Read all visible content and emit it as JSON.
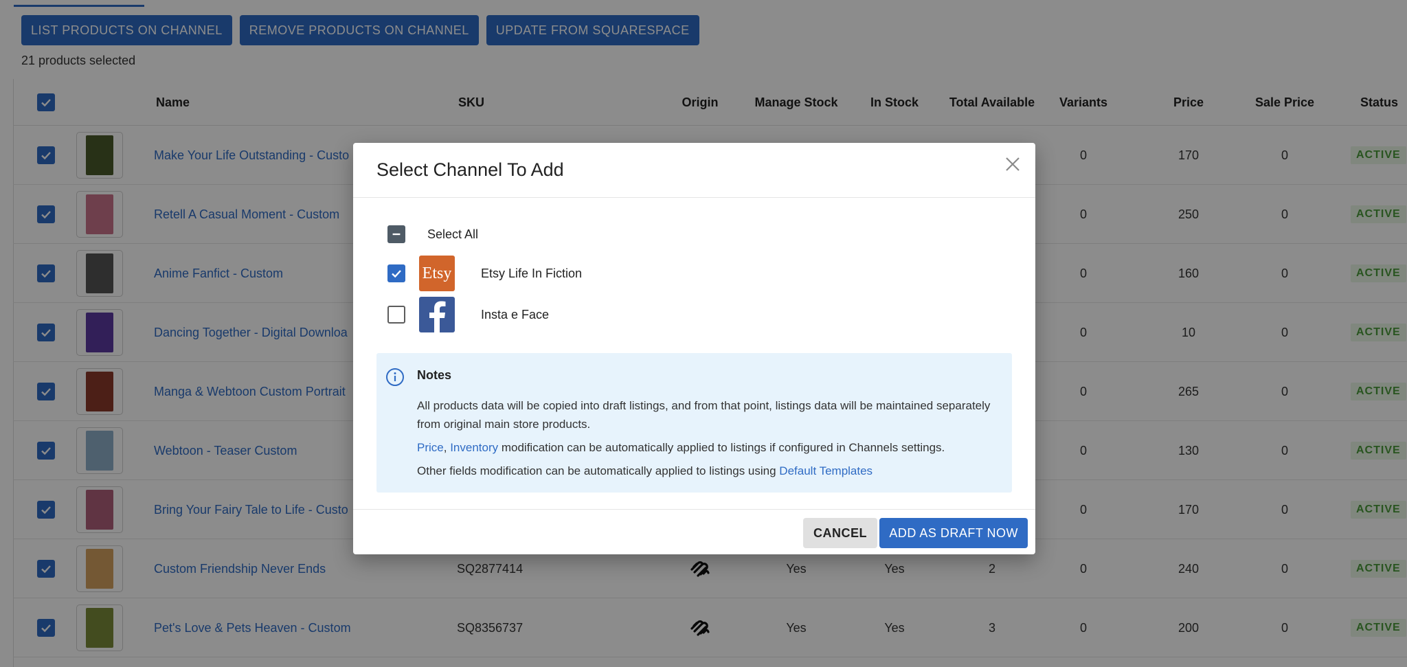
{
  "toolbar": {
    "list_label": "LIST PRODUCTS ON CHANNEL",
    "remove_label": "REMOVE PRODUCTS ON CHANNEL",
    "update_label": "UPDATE FROM SQUARESPACE"
  },
  "selection": {
    "count_text": "21 products selected"
  },
  "table": {
    "columns": [
      "Name",
      "SKU",
      "Origin",
      "Manage Stock",
      "In Stock",
      "Total Available",
      "Variants",
      "Price",
      "Sale Price",
      "Status"
    ],
    "rows": [
      {
        "name": "Make Your Life Outstanding - Custo",
        "sku": "",
        "manage": "",
        "instock": "",
        "total": "",
        "variants": "0",
        "price": "170",
        "sale": "0",
        "status": "ACTIVE",
        "thumb": "#4a5a2a"
      },
      {
        "name": "Retell A Casual Moment - Custom",
        "sku": "",
        "manage": "",
        "instock": "",
        "total": "",
        "variants": "0",
        "price": "250",
        "sale": "0",
        "status": "ACTIVE",
        "thumb": "#c8748a"
      },
      {
        "name": "Anime Fanfict - Custom",
        "sku": "",
        "manage": "",
        "instock": "",
        "total": "",
        "variants": "0",
        "price": "160",
        "sale": "0",
        "status": "ACTIVE",
        "thumb": "#555555"
      },
      {
        "name": "Dancing Together - Digital Downloa",
        "sku": "",
        "manage": "",
        "instock": "",
        "total": "",
        "variants": "0",
        "price": "10",
        "sale": "0",
        "status": "ACTIVE",
        "thumb": "#5b3aa0"
      },
      {
        "name": "Manga & Webtoon Custom Portrait",
        "sku": "",
        "manage": "",
        "instock": "",
        "total": "",
        "variants": "0",
        "price": "265",
        "sale": "0",
        "status": "ACTIVE",
        "thumb": "#8a3a2a"
      },
      {
        "name": "Webtoon - Teaser Custom",
        "sku": "",
        "manage": "",
        "instock": "",
        "total": "",
        "variants": "0",
        "price": "130",
        "sale": "0",
        "status": "ACTIVE",
        "thumb": "#8fb0c8"
      },
      {
        "name": "Bring Your Fairy Tale to Life - Custo",
        "sku": "",
        "manage": "",
        "instock": "",
        "total": "",
        "variants": "0",
        "price": "170",
        "sale": "0",
        "status": "ACTIVE",
        "thumb": "#b0607a"
      },
      {
        "name": "Custom Friendship Never Ends",
        "sku": "SQ2877414",
        "manage": "Yes",
        "instock": "Yes",
        "total": "2",
        "variants": "0",
        "price": "240",
        "sale": "0",
        "status": "ACTIVE",
        "thumb": "#d4a060"
      },
      {
        "name": "Pet's Love & Pets Heaven - Custom",
        "sku": "SQ8356737",
        "manage": "Yes",
        "instock": "Yes",
        "total": "3",
        "variants": "0",
        "price": "200",
        "sale": "0",
        "status": "ACTIVE",
        "thumb": "#7a8a3a"
      }
    ]
  },
  "modal": {
    "title": "Select Channel To Add",
    "select_all_label": "Select All",
    "channels": [
      {
        "label": "Etsy Life In Fiction",
        "logo_text": "Etsy",
        "checked": true,
        "color": "#d1652b"
      },
      {
        "label": "Insta e Face",
        "logo_text": "f",
        "checked": false,
        "color": "#3b5998"
      }
    ],
    "notes": {
      "title": "Notes",
      "line1": "All products data will be copied into draft listings, and from that point, listings data will be maintained separately from original main store products.",
      "price_link": "Price",
      "comma": ", ",
      "inventory_link": "Inventory",
      "line2_rest": " modification can be automatically applied to listings if configured in Channels settings.",
      "line3_prefix": "Other fields modification can be automatically applied to listings using ",
      "templates_link": "Default Templates"
    },
    "cancel_label": "CANCEL",
    "add_label": "ADD AS DRAFT NOW"
  },
  "colors": {
    "primary": "#2f6bc4",
    "status_green": "#4a9a3a",
    "notes_bg": "#e7f3fc"
  }
}
